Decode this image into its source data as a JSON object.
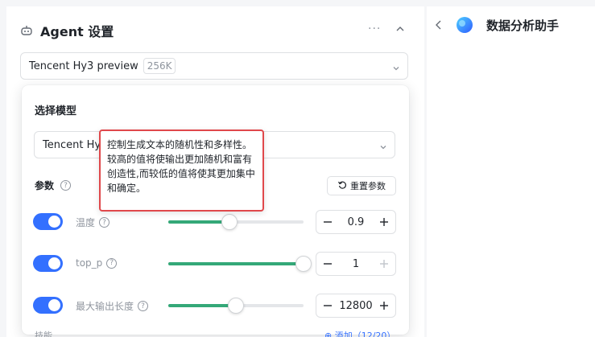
{
  "agent_panel": {
    "title": "Agent 设置",
    "more_label": "···",
    "model_select": {
      "name": "Tencent Hy3 preview",
      "context_badge": "256K"
    }
  },
  "popover": {
    "title": "选择模型",
    "model_select_partial": "Tencent Hy3",
    "params_label": "参数",
    "help_symbol": "?",
    "reset_label": "重置参数",
    "params": [
      {
        "name": "温度",
        "enabled": true,
        "value": "0.9",
        "slider_fraction": 0.45
      },
      {
        "name": "top_p",
        "enabled": true,
        "value": "1",
        "slider_fraction": 1.0
      },
      {
        "name": "最大输出长度",
        "enabled": true,
        "value": "12800",
        "slider_fraction": 0.5
      }
    ],
    "bottom_label": "技能",
    "bottom_link": "⊕ 添加（12/20）"
  },
  "tooltip": {
    "text": "控制生成文本的随机性和多样性。较高的值将使输出更加随机和富有创造性,而较低的值将使其更加集中和确定。"
  },
  "assistant_panel": {
    "title": "数据分析助手"
  },
  "colors": {
    "accent_blue": "#3370ff",
    "slider_green": "#34a878",
    "tooltip_border": "#e0484b"
  }
}
